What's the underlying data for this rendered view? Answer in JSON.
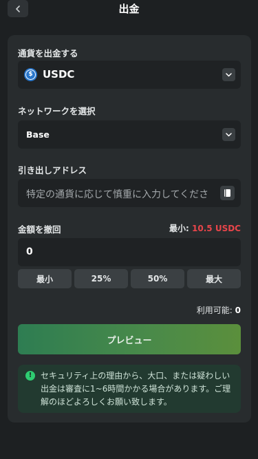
{
  "header": {
    "back_icon": "chevron-left-icon",
    "title": "出金"
  },
  "currency": {
    "label": "通貨を出金する",
    "selected": "USDC",
    "icon": "usdc-coin-icon",
    "icon_color": "#2775ca",
    "dropdown_icon": "chevron-down-icon"
  },
  "network": {
    "label": "ネットワークを選択",
    "selected": "Base",
    "dropdown_icon": "chevron-down-icon"
  },
  "address": {
    "label": "引き出しアドレス",
    "placeholder": "特定の通貨に応じて慎重に入力してくださ",
    "address_book_icon": "address-book-icon"
  },
  "amount": {
    "label": "金額を撤回",
    "min_key": "最小:",
    "min_value": "10.5 USDC",
    "min_color": "#e8454a",
    "value": "0",
    "quick_buttons": [
      "最小",
      "25%",
      "50%",
      "最大"
    ]
  },
  "available": {
    "key": "利用可能:",
    "value": "0"
  },
  "preview_button": "プレビュー",
  "notice": {
    "icon": "exclamation-circle-icon",
    "text": "セキュリティ上の理由から、大口、または疑わしい出金は審査に1~6時間かかる場合があります。ご理解のほどよろしくお願い致します。"
  }
}
